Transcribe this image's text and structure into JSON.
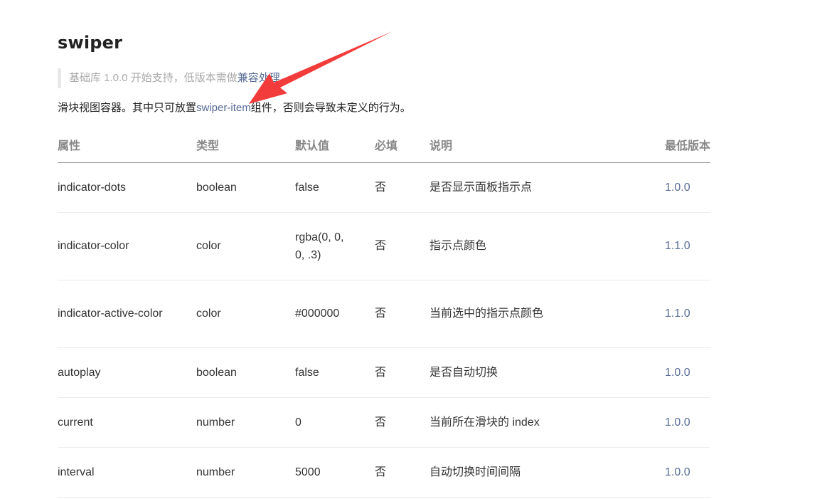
{
  "title": "swiper",
  "note": {
    "text": "基础库 1.0.0 开始支持，低版本需做",
    "link": "兼容处理",
    "suffix": "。"
  },
  "description": {
    "before": "滑块视图容器。其中只可放置",
    "link": "swiper-item",
    "after": "组件，否则会导致未定义的行为。"
  },
  "table": {
    "headers": [
      "属性",
      "类型",
      "默认值",
      "必填",
      "说明",
      "最低版本"
    ],
    "rows": [
      {
        "attr": "indicator-dots",
        "type": "boolean",
        "default": "false",
        "required": "否",
        "desc": "是否显示面板指示点",
        "version": "1.0.0"
      },
      {
        "attr": "indicator-color",
        "type": "color",
        "default": "rgba(0, 0, 0, .3)",
        "required": "否",
        "desc": "指示点颜色",
        "version": "1.1.0"
      },
      {
        "attr": "indicator-active-color",
        "type": "color",
        "default": "#000000",
        "required": "否",
        "desc": "当前选中的指示点颜色",
        "version": "1.1.0"
      },
      {
        "attr": "autoplay",
        "type": "boolean",
        "default": "false",
        "required": "否",
        "desc": "是否自动切换",
        "version": "1.0.0"
      },
      {
        "attr": "current",
        "type": "number",
        "default": "0",
        "required": "否",
        "desc": "当前所在滑块的 index",
        "version": "1.0.0"
      },
      {
        "attr": "interval",
        "type": "number",
        "default": "5000",
        "required": "否",
        "desc": "自动切换时间间隔",
        "version": "1.0.0"
      }
    ]
  },
  "colors": {
    "link": "#576b95",
    "annotation_arrow": "#f23c3c"
  }
}
